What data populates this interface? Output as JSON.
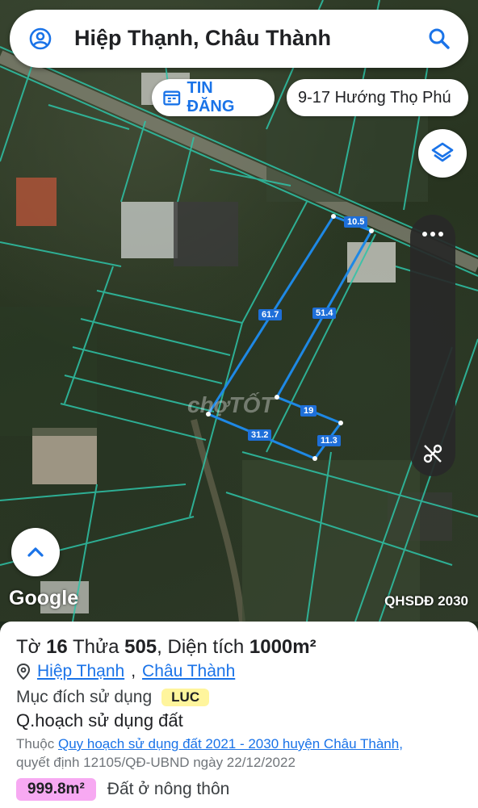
{
  "search": {
    "query": "Hiệp Thạnh, Châu Thành"
  },
  "chips": {
    "news_label": "TIN ĐĂNG",
    "route_label": "9-17 Hướng Thọ Phú"
  },
  "map": {
    "attribution": "Google",
    "plan_layer": "QHSDĐ 2030",
    "watermark": "chợTỐT",
    "dimensions": [
      "10.5",
      "61.7",
      "51.4",
      "19",
      "31.2",
      "11.3"
    ],
    "colors": {
      "parcel_lines": "#2ec4a8",
      "selected_parcel": "#1e88e5"
    }
  },
  "info": {
    "title_prefix": "Tờ",
    "sheet_no": "16",
    "parcel_prefix": "Thửa",
    "parcel_no": "505",
    "area_prefix": ", Diện tích",
    "area_value": "1000m²",
    "commune": "Hiệp Thạnh",
    "district": "Châu Thành",
    "purpose_label": "Mục đích sử dụng",
    "purpose_code": "LUC",
    "plan_title": "Q.hoạch sử dụng đất",
    "plan_prefix": "Thuộc",
    "plan_link": "Quy hoạch sử dụng đất 2021 - 2030 huyện Châu Thành,",
    "decision_text": "quyết định 12105/QĐ-UBND ngày 22/12/2022",
    "plan_area": "999.8m²",
    "plan_area_type": "Đất ở nông thôn"
  }
}
